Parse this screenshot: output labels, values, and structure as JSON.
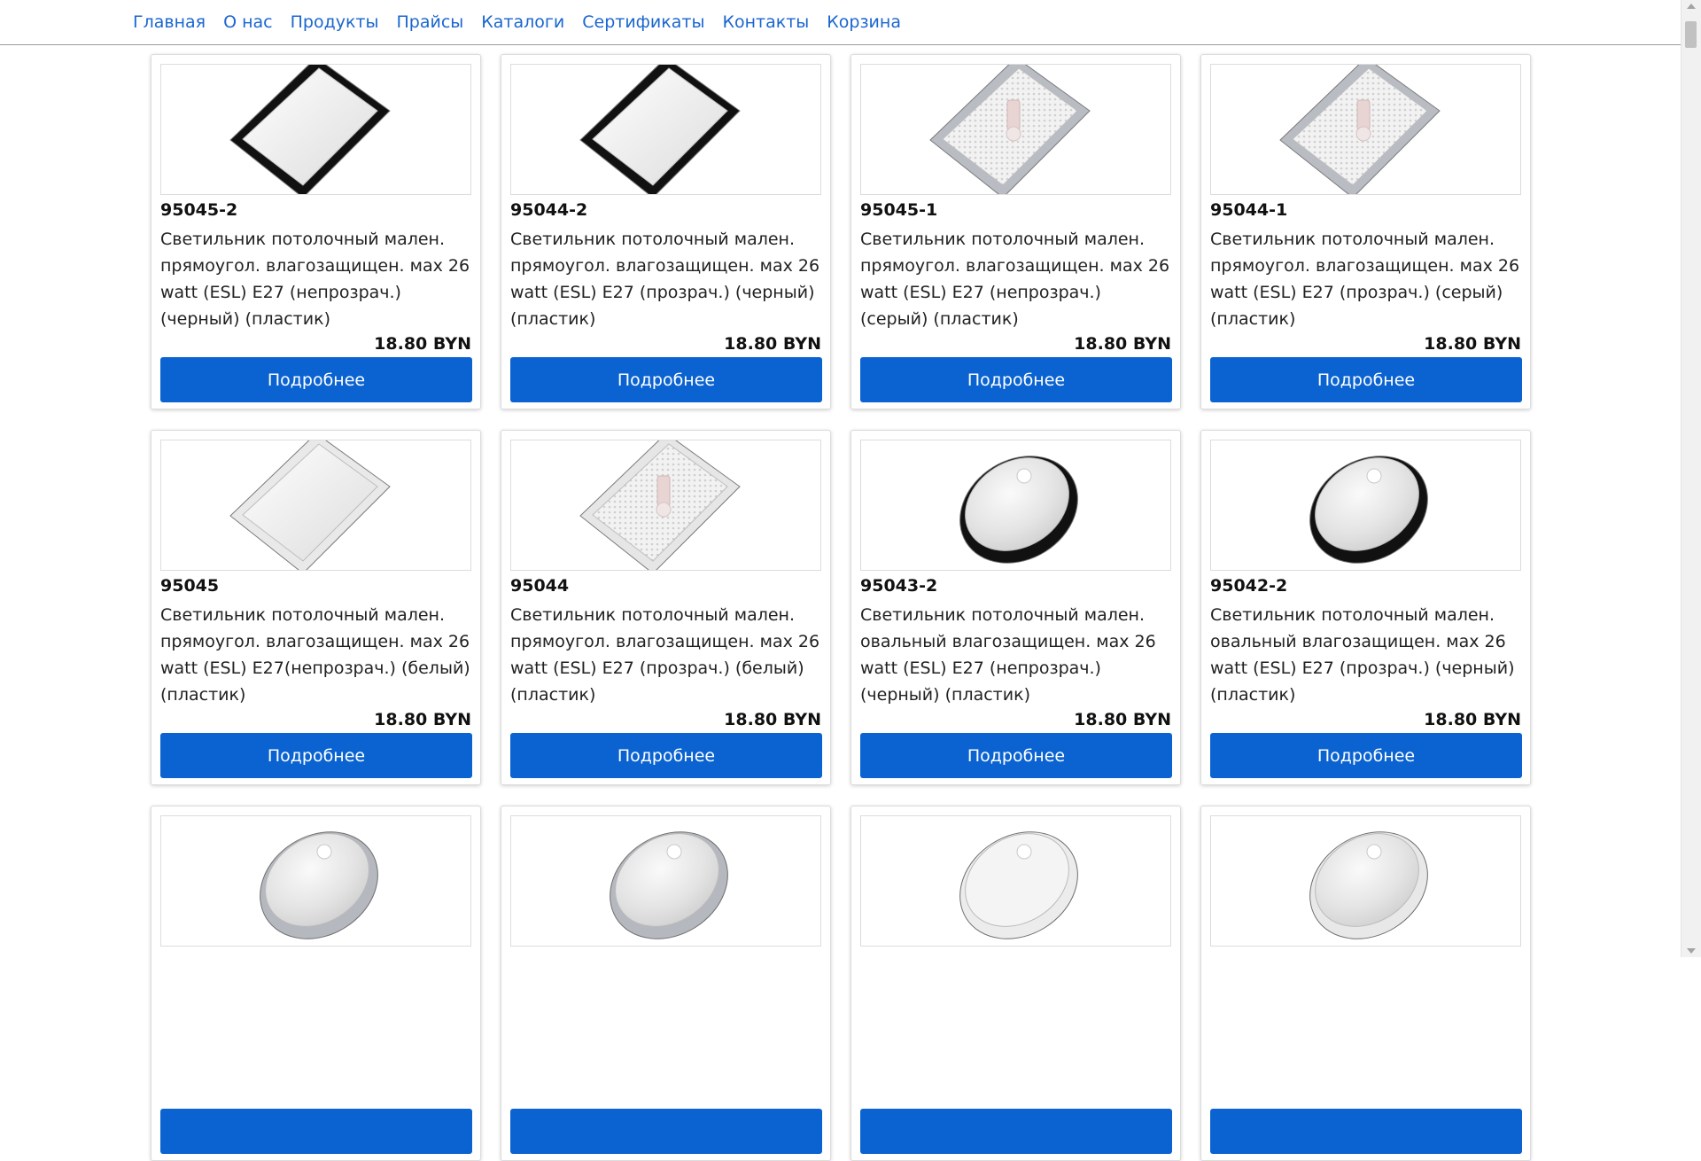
{
  "nav": {
    "items": [
      "Главная",
      "О нас",
      "Продукты",
      "Прайсы",
      "Каталоги",
      "Сертификаты",
      "Контакты",
      "Корзина"
    ]
  },
  "products": [
    {
      "code": "95045-2",
      "desc": "Светильник потолочный мален. прямоугол. влагозащищен. мах 26 watt (ESL) E27 (непрозрач.) (черный) (пластик)",
      "price": "18.80 BYN",
      "button": "Подробнее",
      "shape": "rect",
      "frame": "#111111",
      "lens": "opaque"
    },
    {
      "code": "95044-2",
      "desc": "Светильник потолочный мален. прямоугол. влагозащищен. мах 26 watt (ESL) E27 (прозрач.) (черный) (пластик)",
      "price": "18.80 BYN",
      "button": "Подробнее",
      "shape": "rect",
      "frame": "#111111",
      "lens": "opaque"
    },
    {
      "code": "95045-1",
      "desc": "Светильник потолочный мален. прямоугол. влагозащищен. мах 26 watt (ESL) E27 (непрозрач.) (серый) (пластик)",
      "price": "18.80 BYN",
      "button": "Подробнее",
      "shape": "rect",
      "frame": "#b9bcc2",
      "lens": "clear"
    },
    {
      "code": "95044-1",
      "desc": "Светильник потолочный мален. прямоугол. влагозащищен. мах 26 watt (ESL) E27 (прозрач.) (серый) (пластик)",
      "price": "18.80 BYN",
      "button": "Подробнее",
      "shape": "rect",
      "frame": "#b9bcc2",
      "lens": "clear"
    },
    {
      "code": "95045",
      "desc": "Светильник потолочный мален. прямоугол. влагозащищен. мах 26 watt (ESL) E27(непрозрач.) (белый) (пластик)",
      "price": "18.80 BYN",
      "button": "Подробнее",
      "shape": "rect",
      "frame": "#e9e9e9",
      "lens": "opaque"
    },
    {
      "code": "95044",
      "desc": "Светильник потолочный мален. прямоугол. влагозащищен. мах 26 watt (ESL) E27 (прозрач.) (белый) (пластик)",
      "price": "18.80 BYN",
      "button": "Подробнее",
      "shape": "rect",
      "frame": "#e6e6e6",
      "lens": "clear"
    },
    {
      "code": "95043-2",
      "desc": "Светильник потолочный мален. овальный влагозащищен. мах 26 watt (ESL) E27 (непрозрач.) (черный) (пластик)",
      "price": "18.80 BYN",
      "button": "Подробнее",
      "shape": "oval",
      "frame": "#111111",
      "lens": "clear"
    },
    {
      "code": "95042-2",
      "desc": "Светильник потолочный мален. овальный влагозащищен. мах 26 watt (ESL) E27 (прозрач.) (черный) (пластик)",
      "price": "18.80 BYN",
      "button": "Подробнее",
      "shape": "oval",
      "frame": "#111111",
      "lens": "clear"
    },
    {
      "code": "",
      "desc": "",
      "price": "",
      "button": "",
      "shape": "oval",
      "frame": "#b5b8be",
      "lens": "clear"
    },
    {
      "code": "",
      "desc": "",
      "price": "",
      "button": "",
      "shape": "oval",
      "frame": "#b5b8be",
      "lens": "clear"
    },
    {
      "code": "",
      "desc": "",
      "price": "",
      "button": "",
      "shape": "oval",
      "frame": "#ececec",
      "lens": "opaque"
    },
    {
      "code": "",
      "desc": "",
      "price": "",
      "button": "",
      "shape": "oval",
      "frame": "#e8e8e8",
      "lens": "clear"
    }
  ]
}
